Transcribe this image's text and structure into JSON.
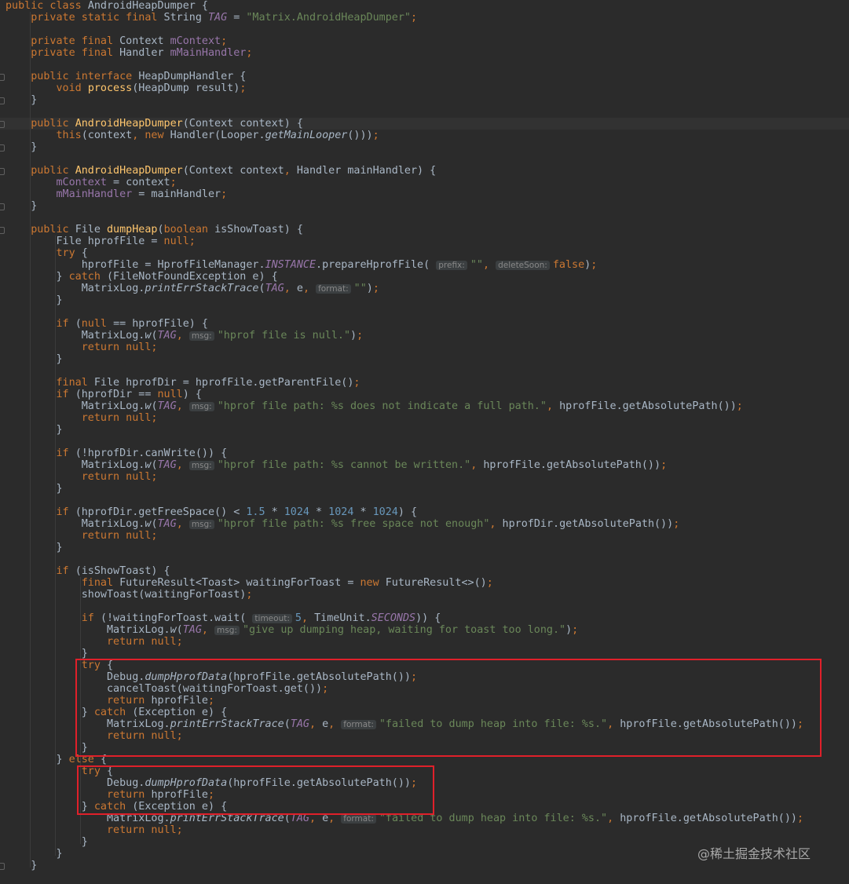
{
  "editor": {
    "lines": [
      [
        [
          "k",
          "public class "
        ],
        [
          "p",
          "AndroidHeapDumper {"
        ]
      ],
      [
        [
          "k",
          "    private static final "
        ],
        [
          "p",
          "String "
        ],
        [
          "fi",
          "TAG"
        ],
        [
          "p",
          " = "
        ],
        [
          "s",
          "\"Matrix.AndroidHeapDumper\""
        ],
        [
          "k",
          ";"
        ]
      ],
      [],
      [
        [
          "k",
          "    private final "
        ],
        [
          "p",
          "Context "
        ],
        [
          "f",
          "mContext"
        ],
        [
          "k",
          ";"
        ]
      ],
      [
        [
          "k",
          "    private final "
        ],
        [
          "p",
          "Handler "
        ],
        [
          "f",
          "mMainHandler"
        ],
        [
          "k",
          ";"
        ]
      ],
      [],
      [
        [
          "k",
          "    public interface "
        ],
        [
          "p",
          "HeapDumpHandler {"
        ]
      ],
      [
        [
          "k",
          "        void "
        ],
        [
          "fn",
          "process"
        ],
        [
          "p",
          "(HeapDump result)"
        ],
        [
          "k",
          ";"
        ]
      ],
      [
        [
          "p",
          "    }"
        ]
      ],
      [],
      [
        [
          "k",
          "    public "
        ],
        [
          "fn",
          "AndroidHeapDumper"
        ],
        [
          "p",
          "(Context context) {"
        ]
      ],
      [
        [
          "k",
          "        this"
        ],
        [
          "p",
          "(context"
        ],
        [
          "k",
          ", new "
        ],
        [
          "p",
          "Handler(Looper."
        ],
        [
          "si",
          "getMainLooper"
        ],
        [
          "p",
          "()))"
        ],
        [
          "k",
          ";"
        ]
      ],
      [
        [
          "p",
          "    }"
        ]
      ],
      [],
      [
        [
          "k",
          "    public "
        ],
        [
          "fn",
          "AndroidHeapDumper"
        ],
        [
          "p",
          "(Context context"
        ],
        [
          "k",
          ", "
        ],
        [
          "p",
          "Handler mainHandler) {"
        ]
      ],
      [
        [
          "f",
          "        mContext"
        ],
        [
          "p",
          " = context"
        ],
        [
          "k",
          ";"
        ]
      ],
      [
        [
          "f",
          "        mMainHandler"
        ],
        [
          "p",
          " = mainHandler"
        ],
        [
          "k",
          ";"
        ]
      ],
      [
        [
          "p",
          "    }"
        ]
      ],
      [],
      [
        [
          "k",
          "    public "
        ],
        [
          "p",
          "File "
        ],
        [
          "fn",
          "dumpHeap"
        ],
        [
          "p",
          "("
        ],
        [
          "k",
          "boolean "
        ],
        [
          "p",
          "isShowToast) {"
        ]
      ],
      [
        [
          "p",
          "        File hprofFile = "
        ],
        [
          "k",
          "null;"
        ]
      ],
      [
        [
          "k",
          "        try "
        ],
        [
          "p",
          "{"
        ]
      ],
      [
        [
          "p",
          "            hprofFile = HprofFileManager."
        ],
        [
          "fi",
          "INSTANCE"
        ],
        [
          "p",
          ".prepareHprofFile( "
        ],
        [
          "h",
          "prefix:"
        ],
        [
          "s",
          "\"\""
        ],
        [
          "k",
          ", "
        ],
        [
          "h",
          "deleteSoon:"
        ],
        [
          "k",
          "false"
        ],
        [
          "p",
          ")"
        ],
        [
          "k",
          ";"
        ]
      ],
      [
        [
          "p",
          "        } "
        ],
        [
          "k",
          "catch "
        ],
        [
          "p",
          "(FileNotFoundException e) {"
        ]
      ],
      [
        [
          "p",
          "            MatrixLog."
        ],
        [
          "si",
          "printErrStackTrace"
        ],
        [
          "p",
          "("
        ],
        [
          "fi",
          "TAG"
        ],
        [
          "k",
          ", "
        ],
        [
          "p",
          "e"
        ],
        [
          "k",
          ", "
        ],
        [
          "h",
          "format:"
        ],
        [
          "s",
          "\"\""
        ],
        [
          "p",
          ")"
        ],
        [
          "k",
          ";"
        ]
      ],
      [
        [
          "p",
          "        }"
        ]
      ],
      [],
      [
        [
          "k",
          "        if "
        ],
        [
          "p",
          "("
        ],
        [
          "k",
          "null "
        ],
        [
          "p",
          "== hprofFile) {"
        ]
      ],
      [
        [
          "p",
          "            MatrixLog."
        ],
        [
          "si",
          "w"
        ],
        [
          "p",
          "("
        ],
        [
          "fi",
          "TAG"
        ],
        [
          "k",
          ", "
        ],
        [
          "h",
          "msg:"
        ],
        [
          "s",
          "\"hprof file is null.\""
        ],
        [
          "p",
          ")"
        ],
        [
          "k",
          ";"
        ]
      ],
      [
        [
          "k",
          "            return null;"
        ]
      ],
      [
        [
          "p",
          "        }"
        ]
      ],
      [],
      [
        [
          "k",
          "        final "
        ],
        [
          "p",
          "File hprofDir = hprofFile.getParentFile()"
        ],
        [
          "k",
          ";"
        ]
      ],
      [
        [
          "k",
          "        if "
        ],
        [
          "p",
          "(hprofDir == "
        ],
        [
          "k",
          "null"
        ],
        [
          "p",
          ") {"
        ]
      ],
      [
        [
          "p",
          "            MatrixLog."
        ],
        [
          "si",
          "w"
        ],
        [
          "p",
          "("
        ],
        [
          "fi",
          "TAG"
        ],
        [
          "k",
          ", "
        ],
        [
          "h",
          "msg:"
        ],
        [
          "s",
          "\"hprof file path: %s does not indicate a full path.\""
        ],
        [
          "k",
          ", "
        ],
        [
          "p",
          "hprofFile.getAbsolutePath())"
        ],
        [
          "k",
          ";"
        ]
      ],
      [
        [
          "k",
          "            return null;"
        ]
      ],
      [
        [
          "p",
          "        }"
        ]
      ],
      [],
      [
        [
          "k",
          "        if "
        ],
        [
          "p",
          "(!hprofDir.canWrite()) {"
        ]
      ],
      [
        [
          "p",
          "            MatrixLog."
        ],
        [
          "si",
          "w"
        ],
        [
          "p",
          "("
        ],
        [
          "fi",
          "TAG"
        ],
        [
          "k",
          ", "
        ],
        [
          "h",
          "msg:"
        ],
        [
          "s",
          "\"hprof file path: %s cannot be written.\""
        ],
        [
          "k",
          ", "
        ],
        [
          "p",
          "hprofFile.getAbsolutePath())"
        ],
        [
          "k",
          ";"
        ]
      ],
      [
        [
          "k",
          "            return null;"
        ]
      ],
      [
        [
          "p",
          "        }"
        ]
      ],
      [],
      [
        [
          "k",
          "        if "
        ],
        [
          "p",
          "(hprofDir.getFreeSpace() < "
        ],
        [
          "n",
          "1.5"
        ],
        [
          "p",
          " * "
        ],
        [
          "n",
          "1024"
        ],
        [
          "p",
          " * "
        ],
        [
          "n",
          "1024"
        ],
        [
          "p",
          " * "
        ],
        [
          "n",
          "1024"
        ],
        [
          "p",
          ") {"
        ]
      ],
      [
        [
          "p",
          "            MatrixLog."
        ],
        [
          "si",
          "w"
        ],
        [
          "p",
          "("
        ],
        [
          "fi",
          "TAG"
        ],
        [
          "k",
          ", "
        ],
        [
          "h",
          "msg:"
        ],
        [
          "s",
          "\"hprof file path: %s free space not enough\""
        ],
        [
          "k",
          ", "
        ],
        [
          "p",
          "hprofDir.getAbsolutePath())"
        ],
        [
          "k",
          ";"
        ]
      ],
      [
        [
          "k",
          "            return null;"
        ]
      ],
      [
        [
          "p",
          "        }"
        ]
      ],
      [],
      [
        [
          "k",
          "        if "
        ],
        [
          "p",
          "(isShowToast) {"
        ]
      ],
      [
        [
          "k",
          "            final "
        ],
        [
          "p",
          "FutureResult<Toast> waitingForToast = "
        ],
        [
          "k",
          "new "
        ],
        [
          "p",
          "FutureResult<>()"
        ],
        [
          "k",
          ";"
        ]
      ],
      [
        [
          "p",
          "            showToast(waitingForToast)"
        ],
        [
          "k",
          ";"
        ]
      ],
      [],
      [
        [
          "k",
          "            if "
        ],
        [
          "p",
          "(!waitingForToast.wait( "
        ],
        [
          "h",
          "timeout:"
        ],
        [
          "n",
          "5"
        ],
        [
          "k",
          ", "
        ],
        [
          "p",
          "TimeUnit."
        ],
        [
          "fi",
          "SECONDS"
        ],
        [
          "p",
          ")) {"
        ]
      ],
      [
        [
          "p",
          "                MatrixLog."
        ],
        [
          "si",
          "w"
        ],
        [
          "p",
          "("
        ],
        [
          "fi",
          "TAG"
        ],
        [
          "k",
          ", "
        ],
        [
          "h",
          "msg:"
        ],
        [
          "s",
          "\"give up dumping heap, waiting for toast too long.\""
        ],
        [
          "p",
          ")"
        ],
        [
          "k",
          ";"
        ]
      ],
      [
        [
          "k",
          "                return null;"
        ]
      ],
      [
        [
          "p",
          "            }"
        ]
      ],
      [
        [
          "k",
          "            try "
        ],
        [
          "p",
          "{"
        ]
      ],
      [
        [
          "p",
          "                Debug."
        ],
        [
          "si",
          "dumpHprofData"
        ],
        [
          "p",
          "(hprofFile.getAbsolutePath())"
        ],
        [
          "k",
          ";"
        ]
      ],
      [
        [
          "p",
          "                cancelToast(waitingForToast.get())"
        ],
        [
          "k",
          ";"
        ]
      ],
      [
        [
          "k",
          "                return "
        ],
        [
          "p",
          "hprofFile"
        ],
        [
          "k",
          ";"
        ]
      ],
      [
        [
          "p",
          "            } "
        ],
        [
          "k",
          "catch "
        ],
        [
          "p",
          "(Exception e) {"
        ]
      ],
      [
        [
          "p",
          "                MatrixLog."
        ],
        [
          "si",
          "printErrStackTrace"
        ],
        [
          "p",
          "("
        ],
        [
          "fi",
          "TAG"
        ],
        [
          "k",
          ", "
        ],
        [
          "p",
          "e"
        ],
        [
          "k",
          ", "
        ],
        [
          "h",
          "format:"
        ],
        [
          "s",
          "\"failed to dump heap into file: %s.\""
        ],
        [
          "k",
          ", "
        ],
        [
          "p",
          "hprofFile.getAbsolutePath())"
        ],
        [
          "k",
          ";"
        ]
      ],
      [
        [
          "k",
          "                return null;"
        ]
      ],
      [
        [
          "p",
          "            }"
        ]
      ],
      [
        [
          "p",
          "        } "
        ],
        [
          "k",
          "else "
        ],
        [
          "p",
          "{"
        ]
      ],
      [
        [
          "k",
          "            try "
        ],
        [
          "p",
          "{"
        ]
      ],
      [
        [
          "p",
          "                Debug."
        ],
        [
          "si",
          "dumpHprofData"
        ],
        [
          "p",
          "(hprofFile.getAbsolutePath())"
        ],
        [
          "k",
          ";"
        ]
      ],
      [
        [
          "k",
          "                return "
        ],
        [
          "p",
          "hprofFile"
        ],
        [
          "k",
          ";"
        ]
      ],
      [
        [
          "p",
          "            } "
        ],
        [
          "k",
          "catch "
        ],
        [
          "p",
          "(Exception e) {"
        ]
      ],
      [
        [
          "p",
          "                MatrixLog."
        ],
        [
          "si",
          "printErrStackTrace"
        ],
        [
          "p",
          "("
        ],
        [
          "fi",
          "TAG"
        ],
        [
          "k",
          ", "
        ],
        [
          "p",
          "e"
        ],
        [
          "k",
          ", "
        ],
        [
          "h",
          "format:"
        ],
        [
          "s",
          "\"failed to dump heap into file: %s.\""
        ],
        [
          "k",
          ", "
        ],
        [
          "p",
          "hprofFile.getAbsolutePath())"
        ],
        [
          "k",
          ";"
        ]
      ],
      [
        [
          "k",
          "                return null;"
        ]
      ],
      [
        [
          "p",
          "            }"
        ]
      ],
      [
        [
          "p",
          "        }"
        ]
      ],
      [
        [
          "p",
          "    }"
        ]
      ]
    ]
  },
  "watermark": "@稀土掘金技术社区",
  "colors": {
    "background": "#2b2b2b",
    "keyword": "#cc7832",
    "string": "#6a8759",
    "number": "#6897bb",
    "field": "#9876aa",
    "function_name": "#ffc66d",
    "plain": "#a9b7c6",
    "annotation_box": "#e0202a"
  }
}
